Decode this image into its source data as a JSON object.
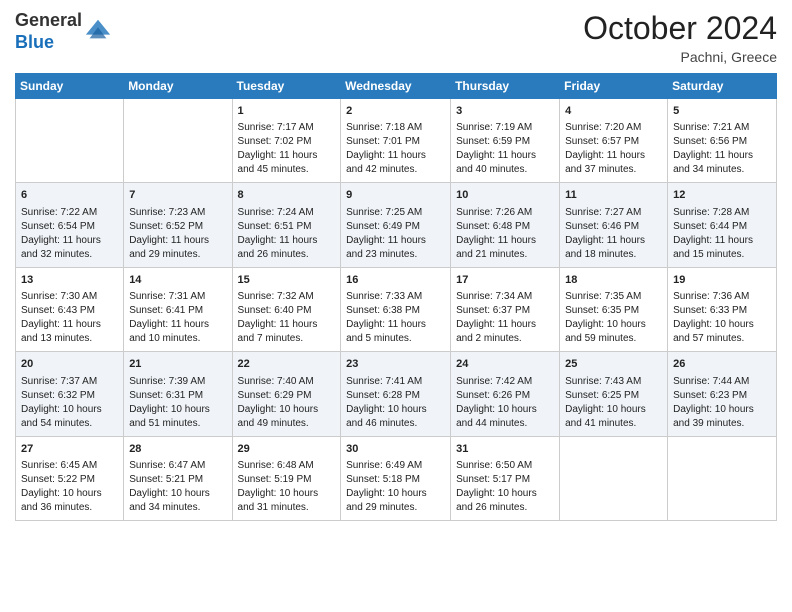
{
  "header": {
    "logo_general": "General",
    "logo_blue": "Blue",
    "month": "October 2024",
    "location": "Pachni, Greece"
  },
  "weekdays": [
    "Sunday",
    "Monday",
    "Tuesday",
    "Wednesday",
    "Thursday",
    "Friday",
    "Saturday"
  ],
  "weeks": [
    [
      {
        "day": "",
        "sunrise": "",
        "sunset": "",
        "daylight": ""
      },
      {
        "day": "",
        "sunrise": "",
        "sunset": "",
        "daylight": ""
      },
      {
        "day": "1",
        "sunrise": "Sunrise: 7:17 AM",
        "sunset": "Sunset: 7:02 PM",
        "daylight": "Daylight: 11 hours and 45 minutes."
      },
      {
        "day": "2",
        "sunrise": "Sunrise: 7:18 AM",
        "sunset": "Sunset: 7:01 PM",
        "daylight": "Daylight: 11 hours and 42 minutes."
      },
      {
        "day": "3",
        "sunrise": "Sunrise: 7:19 AM",
        "sunset": "Sunset: 6:59 PM",
        "daylight": "Daylight: 11 hours and 40 minutes."
      },
      {
        "day": "4",
        "sunrise": "Sunrise: 7:20 AM",
        "sunset": "Sunset: 6:57 PM",
        "daylight": "Daylight: 11 hours and 37 minutes."
      },
      {
        "day": "5",
        "sunrise": "Sunrise: 7:21 AM",
        "sunset": "Sunset: 6:56 PM",
        "daylight": "Daylight: 11 hours and 34 minutes."
      }
    ],
    [
      {
        "day": "6",
        "sunrise": "Sunrise: 7:22 AM",
        "sunset": "Sunset: 6:54 PM",
        "daylight": "Daylight: 11 hours and 32 minutes."
      },
      {
        "day": "7",
        "sunrise": "Sunrise: 7:23 AM",
        "sunset": "Sunset: 6:52 PM",
        "daylight": "Daylight: 11 hours and 29 minutes."
      },
      {
        "day": "8",
        "sunrise": "Sunrise: 7:24 AM",
        "sunset": "Sunset: 6:51 PM",
        "daylight": "Daylight: 11 hours and 26 minutes."
      },
      {
        "day": "9",
        "sunrise": "Sunrise: 7:25 AM",
        "sunset": "Sunset: 6:49 PM",
        "daylight": "Daylight: 11 hours and 23 minutes."
      },
      {
        "day": "10",
        "sunrise": "Sunrise: 7:26 AM",
        "sunset": "Sunset: 6:48 PM",
        "daylight": "Daylight: 11 hours and 21 minutes."
      },
      {
        "day": "11",
        "sunrise": "Sunrise: 7:27 AM",
        "sunset": "Sunset: 6:46 PM",
        "daylight": "Daylight: 11 hours and 18 minutes."
      },
      {
        "day": "12",
        "sunrise": "Sunrise: 7:28 AM",
        "sunset": "Sunset: 6:44 PM",
        "daylight": "Daylight: 11 hours and 15 minutes."
      }
    ],
    [
      {
        "day": "13",
        "sunrise": "Sunrise: 7:30 AM",
        "sunset": "Sunset: 6:43 PM",
        "daylight": "Daylight: 11 hours and 13 minutes."
      },
      {
        "day": "14",
        "sunrise": "Sunrise: 7:31 AM",
        "sunset": "Sunset: 6:41 PM",
        "daylight": "Daylight: 11 hours and 10 minutes."
      },
      {
        "day": "15",
        "sunrise": "Sunrise: 7:32 AM",
        "sunset": "Sunset: 6:40 PM",
        "daylight": "Daylight: 11 hours and 7 minutes."
      },
      {
        "day": "16",
        "sunrise": "Sunrise: 7:33 AM",
        "sunset": "Sunset: 6:38 PM",
        "daylight": "Daylight: 11 hours and 5 minutes."
      },
      {
        "day": "17",
        "sunrise": "Sunrise: 7:34 AM",
        "sunset": "Sunset: 6:37 PM",
        "daylight": "Daylight: 11 hours and 2 minutes."
      },
      {
        "day": "18",
        "sunrise": "Sunrise: 7:35 AM",
        "sunset": "Sunset: 6:35 PM",
        "daylight": "Daylight: 10 hours and 59 minutes."
      },
      {
        "day": "19",
        "sunrise": "Sunrise: 7:36 AM",
        "sunset": "Sunset: 6:33 PM",
        "daylight": "Daylight: 10 hours and 57 minutes."
      }
    ],
    [
      {
        "day": "20",
        "sunrise": "Sunrise: 7:37 AM",
        "sunset": "Sunset: 6:32 PM",
        "daylight": "Daylight: 10 hours and 54 minutes."
      },
      {
        "day": "21",
        "sunrise": "Sunrise: 7:39 AM",
        "sunset": "Sunset: 6:31 PM",
        "daylight": "Daylight: 10 hours and 51 minutes."
      },
      {
        "day": "22",
        "sunrise": "Sunrise: 7:40 AM",
        "sunset": "Sunset: 6:29 PM",
        "daylight": "Daylight: 10 hours and 49 minutes."
      },
      {
        "day": "23",
        "sunrise": "Sunrise: 7:41 AM",
        "sunset": "Sunset: 6:28 PM",
        "daylight": "Daylight: 10 hours and 46 minutes."
      },
      {
        "day": "24",
        "sunrise": "Sunrise: 7:42 AM",
        "sunset": "Sunset: 6:26 PM",
        "daylight": "Daylight: 10 hours and 44 minutes."
      },
      {
        "day": "25",
        "sunrise": "Sunrise: 7:43 AM",
        "sunset": "Sunset: 6:25 PM",
        "daylight": "Daylight: 10 hours and 41 minutes."
      },
      {
        "day": "26",
        "sunrise": "Sunrise: 7:44 AM",
        "sunset": "Sunset: 6:23 PM",
        "daylight": "Daylight: 10 hours and 39 minutes."
      }
    ],
    [
      {
        "day": "27",
        "sunrise": "Sunrise: 6:45 AM",
        "sunset": "Sunset: 5:22 PM",
        "daylight": "Daylight: 10 hours and 36 minutes."
      },
      {
        "day": "28",
        "sunrise": "Sunrise: 6:47 AM",
        "sunset": "Sunset: 5:21 PM",
        "daylight": "Daylight: 10 hours and 34 minutes."
      },
      {
        "day": "29",
        "sunrise": "Sunrise: 6:48 AM",
        "sunset": "Sunset: 5:19 PM",
        "daylight": "Daylight: 10 hours and 31 minutes."
      },
      {
        "day": "30",
        "sunrise": "Sunrise: 6:49 AM",
        "sunset": "Sunset: 5:18 PM",
        "daylight": "Daylight: 10 hours and 29 minutes."
      },
      {
        "day": "31",
        "sunrise": "Sunrise: 6:50 AM",
        "sunset": "Sunset: 5:17 PM",
        "daylight": "Daylight: 10 hours and 26 minutes."
      },
      {
        "day": "",
        "sunrise": "",
        "sunset": "",
        "daylight": ""
      },
      {
        "day": "",
        "sunrise": "",
        "sunset": "",
        "daylight": ""
      }
    ]
  ]
}
